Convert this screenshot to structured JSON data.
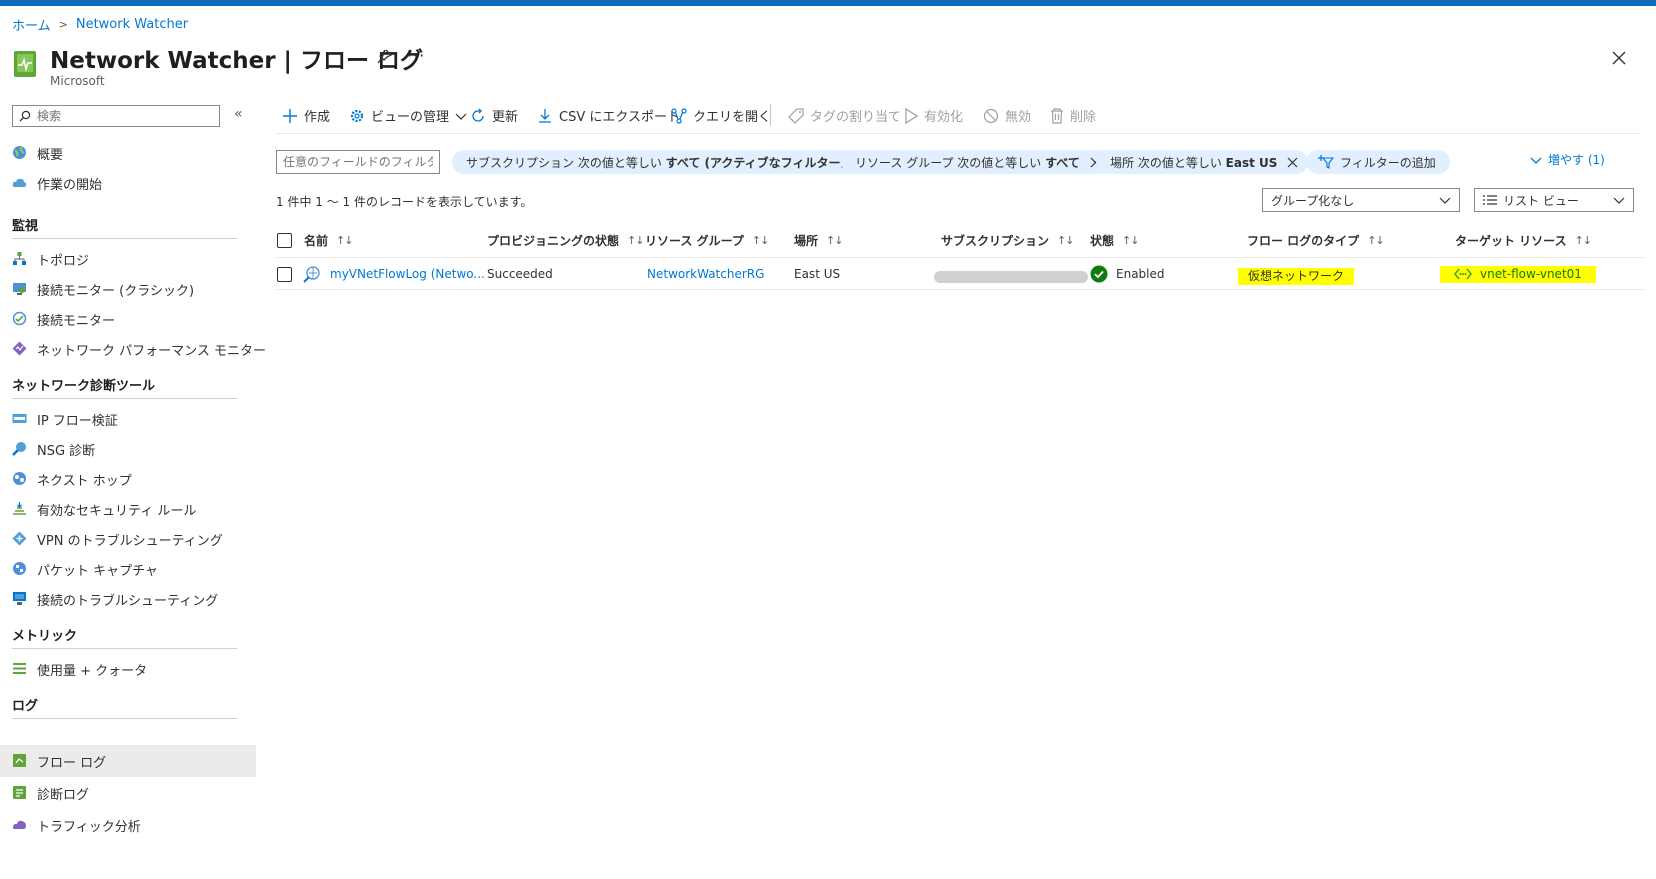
{
  "breadcrumb": {
    "home": "ホーム",
    "current": "Network Watcher"
  },
  "header": {
    "title": "Network Watcher | フロー ログ",
    "subtitle": "Microsoft",
    "more": "···"
  },
  "sidebar": {
    "search_placeholder": "検索",
    "collapse": "«",
    "items_top": [
      {
        "label": "概要",
        "icon": "globe-icon"
      },
      {
        "label": "作業の開始",
        "icon": "cloud-icon"
      }
    ],
    "sections": [
      {
        "title": "監視",
        "items": [
          {
            "label": "トポロジ",
            "icon": "topology-icon"
          },
          {
            "label": "接続モニター (クラシック)",
            "icon": "monitor-classic-icon"
          },
          {
            "label": "接続モニター",
            "icon": "connection-monitor-icon"
          },
          {
            "label": "ネットワーク パフォーマンス モニター",
            "icon": "network-performance-icon"
          }
        ]
      },
      {
        "title": "ネットワーク診断ツール",
        "items": [
          {
            "label": "IP フロー検証",
            "icon": "ip-flow-icon"
          },
          {
            "label": "NSG 診断",
            "icon": "nsg-diagnostic-icon"
          },
          {
            "label": "ネクスト ホップ",
            "icon": "next-hop-icon"
          },
          {
            "label": "有効なセキュリティ ルール",
            "icon": "security-rules-icon"
          },
          {
            "label": "VPN のトラブルシューティング",
            "icon": "vpn-troubleshoot-icon"
          },
          {
            "label": "パケット キャプチャ",
            "icon": "packet-capture-icon"
          },
          {
            "label": "接続のトラブルシューティング",
            "icon": "connection-troubleshoot-icon"
          }
        ]
      },
      {
        "title": "メトリック",
        "items": [
          {
            "label": "使用量 + クォータ",
            "icon": "usage-quota-icon"
          }
        ]
      },
      {
        "title": "ログ",
        "items": [
          {
            "label": "フロー ログ",
            "icon": "flow-log-icon",
            "active": true
          },
          {
            "label": "診断ログ",
            "icon": "diagnostic-log-icon"
          },
          {
            "label": "トラフィック分析",
            "icon": "traffic-analytics-icon"
          }
        ]
      }
    ]
  },
  "toolbar": {
    "create": "作成",
    "manage_view": "ビューの管理",
    "refresh": "更新",
    "export_csv": "CSV にエクスポート",
    "open_query": "クエリを開く",
    "assign_tags": "タグの割り当て",
    "enable": "有効化",
    "disable": "無効",
    "delete": "削除"
  },
  "filters": {
    "placeholder": "任意のフィールドのフィルター...",
    "subscription": {
      "prefix": "サブスクリプション 次の値と等しい",
      "value": "すべて (アクティブなフィルターから)"
    },
    "resource_group": {
      "prefix": "リソース グループ 次の値と等しい",
      "value": "すべて"
    },
    "location": {
      "prefix": "場所 次の値と等しい",
      "value": "East US"
    },
    "add_filter": "フィルターの追加",
    "more": "増やす (1)"
  },
  "record_count": "1 件中 1 ～ 1 件のレコードを表示しています。",
  "grouping": "グループ化なし",
  "view_mode": "リスト ビュー",
  "table": {
    "columns": [
      "名前",
      "プロビジョニングの状態",
      "リソース グループ",
      "場所",
      "サブスクリプション",
      "状態",
      "フロー ログのタイプ",
      "ターゲット リソース"
    ],
    "sort_glyph": "↑↓",
    "rows": [
      {
        "name": "myVNetFlowLog (Netwo...",
        "provisioning": "Succeeded",
        "resource_group": "NetworkWatcherRG",
        "location": "East US",
        "subscription": "",
        "status": "Enabled",
        "flow_log_type": "仮想ネットワーク",
        "target_resource": "vnet-flow-vnet01"
      }
    ]
  },
  "colors": {
    "accent": "#0078d4",
    "highlight": "#ffff00",
    "success": "#107c10",
    "topbar": "#0f6cbd"
  }
}
